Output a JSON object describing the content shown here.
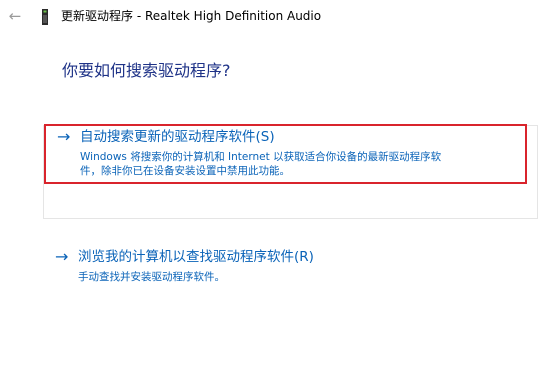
{
  "window": {
    "title": "更新驱动程序 - Realtek High Definition Audio",
    "back_glyph": "←"
  },
  "heading": "你要如何搜索驱动程序?",
  "options": [
    {
      "arrow": "→",
      "title": "自动搜索更新的驱动程序软件(S)",
      "desc_line1": "Windows 将搜索你的计算机和 Internet 以获取适合你设备的最新驱动程序软",
      "desc_line2": "件，除非你已在设备安装设置中禁用此功能。",
      "highlighted": true
    },
    {
      "arrow": "→",
      "title": "浏览我的计算机以查找驱动程序软件(R)",
      "desc_line1": "手动查找并安装驱动程序软件。"
    }
  ],
  "colors": {
    "link_blue": "#0a63b8",
    "heading_blue": "#1e3287",
    "highlight_red": "#d9242c"
  },
  "icons": {
    "back": "back-arrow-icon",
    "device": "device-icon"
  }
}
